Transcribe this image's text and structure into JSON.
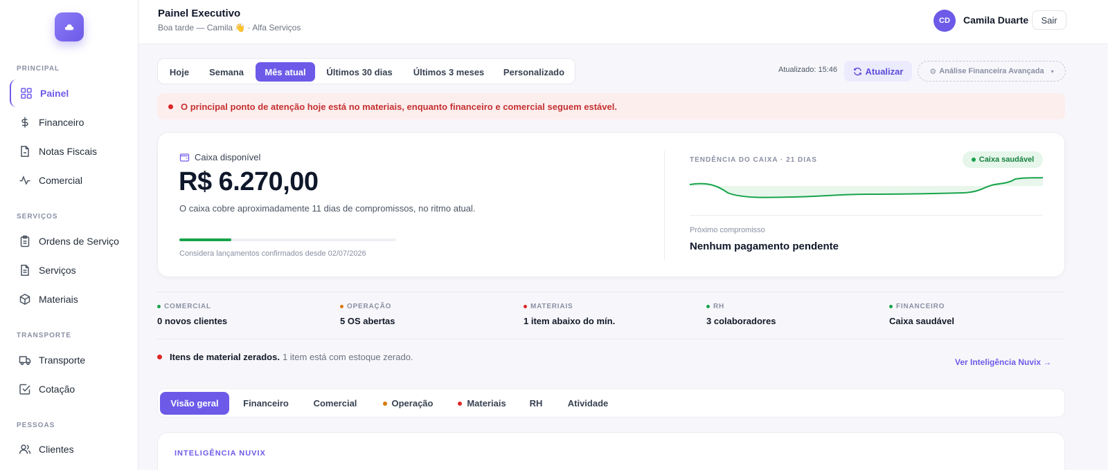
{
  "sidebar": {
    "sections": [
      "PRINCIPAL",
      "SERVIÇOS",
      "TRANSPORTE",
      "PESSOAS"
    ],
    "items": [
      {
        "label": "Painel",
        "icon": "grid-icon",
        "active": true
      },
      {
        "label": "Financeiro",
        "icon": "dollar-icon"
      },
      {
        "label": "Notas Fiscais",
        "icon": "invoice-icon"
      },
      {
        "label": "Comercial",
        "icon": "activity-icon"
      },
      {
        "label": "Ordens de Serviço",
        "icon": "clipboard-icon"
      },
      {
        "label": "Serviços",
        "icon": "document-icon"
      },
      {
        "label": "Materiais",
        "icon": "box-icon"
      },
      {
        "label": "Transporte",
        "icon": "truck-icon"
      },
      {
        "label": "Cotação",
        "icon": "checkbox-icon"
      },
      {
        "label": "Clientes",
        "icon": "users-icon"
      }
    ]
  },
  "header": {
    "title": "Painel Executivo",
    "subtitle": "Boa tarde — Camila 👋 · Alfa Serviços",
    "avatar_initials": "CD",
    "user_name": "Camila Duarte",
    "logout_label": "Sair"
  },
  "period_tabs": [
    "Hoje",
    "Semana",
    "Mês atual",
    "Últimos 30 dias",
    "Últimos 3 meses",
    "Personalizado"
  ],
  "period_active": "Mês atual",
  "toolbar": {
    "updated": "Atualizado: 15:46",
    "refresh_label": "Atualizar",
    "advanced_label": "Análise Financeira Avançada"
  },
  "alert": {
    "text": "O principal ponto de atenção hoje está no materiais, enquanto financeiro e comercial seguem estável."
  },
  "cash": {
    "label": "Caixa disponível",
    "value": "R$ 6.270,00",
    "description": "O caixa cobre aproximadamente 11 dias de compromissos, no ritmo atual.",
    "progress": 0.24,
    "footnote": "Considera lançamentos confirmados desde 02/07/2026",
    "trend_title": "TENDÊNCIA DO CAIXA · 21 DIAS",
    "status_badge": "Caixa saudável",
    "next_label": "Próximo compromisso",
    "next_value": "Nenhum pagamento pendente"
  },
  "kpis": [
    {
      "label": "COMERCIAL",
      "value": "0 novos clientes",
      "color": "#16a34a"
    },
    {
      "label": "OPERAÇÃO",
      "value": "5 OS abertas",
      "color": "#d97706"
    },
    {
      "label": "MATERIAIS",
      "value": "1 item abaixo do mín.",
      "color": "#dc2626"
    },
    {
      "label": "RH",
      "value": "3 colaboradores",
      "color": "#16a34a"
    },
    {
      "label": "FINANCEIRO",
      "value": "Caixa saudável",
      "color": "#16a34a"
    }
  ],
  "notice": {
    "title": "Itens de material zerados.",
    "text": "1 item está com estoque zerado.",
    "link": "Ver Inteligência Nuvix →"
  },
  "section_tabs": [
    {
      "label": "Visão geral",
      "active": true
    },
    {
      "label": "Financeiro"
    },
    {
      "label": "Comercial"
    },
    {
      "label": "Operação",
      "dot": "#d97706"
    },
    {
      "label": "Materiais",
      "dot": "#dc2626"
    },
    {
      "label": "RH"
    },
    {
      "label": "Atividade"
    }
  ],
  "intel": {
    "title": "INTELIGÊNCIA NUVIX"
  },
  "colors": {
    "accent": "#6d5ae8",
    "success": "#16a34a",
    "warning": "#d97706",
    "danger": "#dc2626"
  }
}
